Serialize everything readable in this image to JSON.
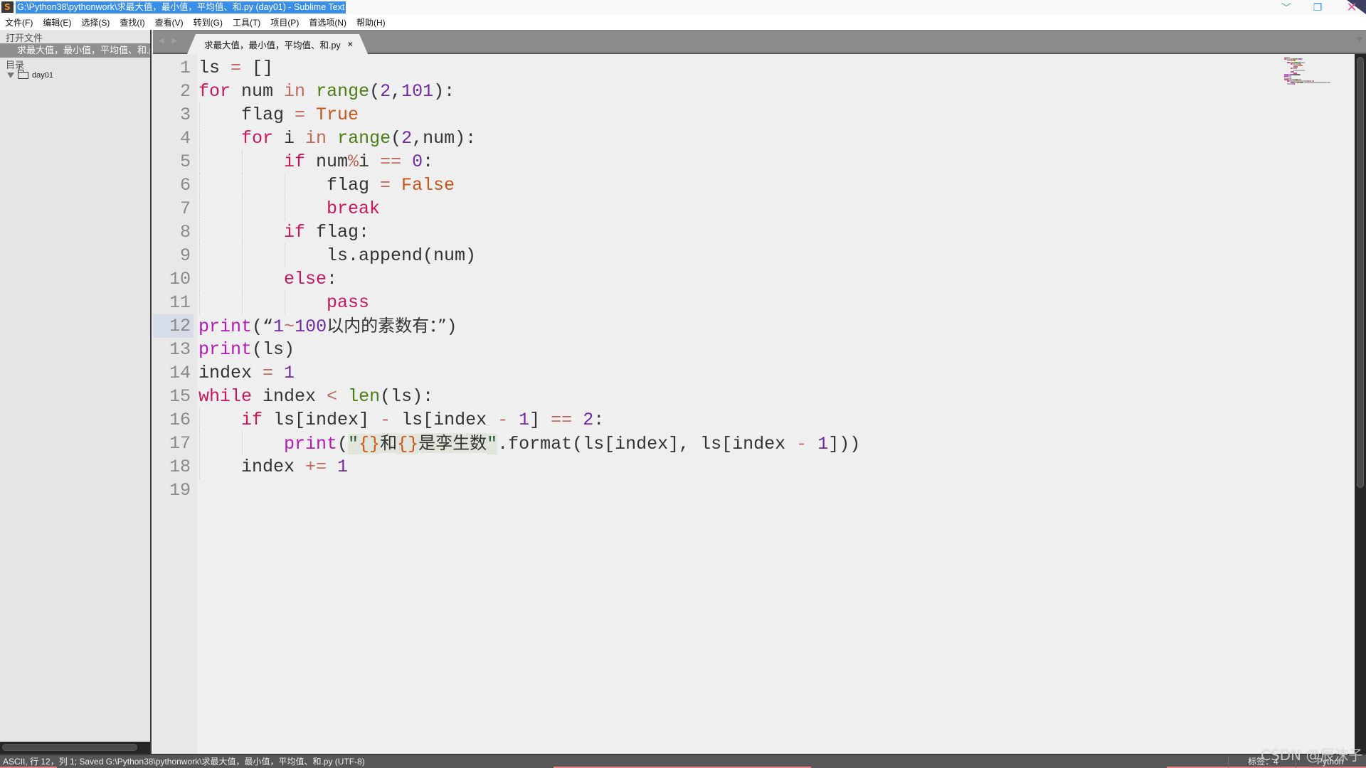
{
  "window": {
    "title": "G:\\Python38\\pythonwork\\求最大值，最小值，平均值、和.py (day01) - Sublime Text",
    "controls": {
      "minimize": "﹀",
      "maximize": "❐",
      "close": "✕"
    }
  },
  "menu": [
    {
      "label": "文件(F)"
    },
    {
      "label": "编辑(E)"
    },
    {
      "label": "选择(S)"
    },
    {
      "label": "查找(I)"
    },
    {
      "label": "查看(V)"
    },
    {
      "label": "转到(G)"
    },
    {
      "label": "工具(T)"
    },
    {
      "label": "项目(P)"
    },
    {
      "label": "首选项(N)"
    },
    {
      "label": "帮助(H)"
    }
  ],
  "sidebar": {
    "open_files_heading": "打开文件",
    "open_files": [
      "求最大值，最小值，平均值、和.py"
    ],
    "folders_heading": "目录",
    "folders": [
      {
        "name": "day01",
        "expanded": true
      }
    ]
  },
  "tabs": [
    {
      "label": "求最大值，最小值，平均值、和.py",
      "close": "×",
      "active": true
    }
  ],
  "tab_nav": "◀ ▶",
  "editor": {
    "current_line": 12,
    "lines": [
      {
        "n": "1",
        "indent": 0,
        "tokens": [
          [
            "txt",
            "ls "
          ],
          [
            "op",
            "="
          ],
          [
            "txt",
            " []"
          ]
        ]
      },
      {
        "n": "2",
        "indent": 0,
        "tokens": [
          [
            "kw",
            "for"
          ],
          [
            "txt",
            " num "
          ],
          [
            "op",
            "in"
          ],
          [
            "txt",
            " "
          ],
          [
            "fn",
            "range"
          ],
          [
            "txt",
            "("
          ],
          [
            "num",
            "2"
          ],
          [
            "txt",
            ","
          ],
          [
            "num",
            "101"
          ],
          [
            "txt",
            "):"
          ]
        ]
      },
      {
        "n": "3",
        "indent": 1,
        "tokens": [
          [
            "txt",
            "flag "
          ],
          [
            "op",
            "="
          ],
          [
            "txt",
            " "
          ],
          [
            "const",
            "True"
          ]
        ]
      },
      {
        "n": "4",
        "indent": 1,
        "tokens": [
          [
            "kw",
            "for"
          ],
          [
            "txt",
            " i "
          ],
          [
            "op",
            "in"
          ],
          [
            "txt",
            " "
          ],
          [
            "fn",
            "range"
          ],
          [
            "txt",
            "("
          ],
          [
            "num",
            "2"
          ],
          [
            "txt",
            ",num):"
          ]
        ]
      },
      {
        "n": "5",
        "indent": 2,
        "tokens": [
          [
            "kw",
            "if"
          ],
          [
            "txt",
            " num"
          ],
          [
            "op",
            "%"
          ],
          [
            "txt",
            "i "
          ],
          [
            "op",
            "=="
          ],
          [
            "txt",
            " "
          ],
          [
            "num",
            "0"
          ],
          [
            "txt",
            ":"
          ]
        ]
      },
      {
        "n": "6",
        "indent": 3,
        "tokens": [
          [
            "txt",
            "flag "
          ],
          [
            "op",
            "="
          ],
          [
            "txt",
            " "
          ],
          [
            "const",
            "False"
          ]
        ]
      },
      {
        "n": "7",
        "indent": 3,
        "tokens": [
          [
            "kw",
            "break"
          ]
        ]
      },
      {
        "n": "8",
        "indent": 2,
        "tokens": [
          [
            "kw",
            "if"
          ],
          [
            "txt",
            " flag:"
          ]
        ]
      },
      {
        "n": "9",
        "indent": 3,
        "tokens": [
          [
            "txt",
            "ls.append(num)"
          ]
        ]
      },
      {
        "n": "10",
        "indent": 2,
        "tokens": [
          [
            "kw",
            "else"
          ],
          [
            "txt",
            ":"
          ]
        ]
      },
      {
        "n": "11",
        "indent": 3,
        "tokens": [
          [
            "kw",
            "pass"
          ]
        ]
      },
      {
        "n": "12",
        "indent": 0,
        "tokens": [
          [
            "print",
            "print"
          ],
          [
            "txt",
            "(“"
          ],
          [
            "num",
            "1"
          ],
          [
            "op",
            "~"
          ],
          [
            "num",
            "100"
          ],
          [
            "cjk",
            "以内的素数有：”"
          ],
          [
            "txt",
            ")"
          ]
        ]
      },
      {
        "n": "13",
        "indent": 0,
        "tokens": [
          [
            "print",
            "print"
          ],
          [
            "txt",
            "(ls)"
          ]
        ]
      },
      {
        "n": "14",
        "indent": 0,
        "tokens": [
          [
            "txt",
            "index "
          ],
          [
            "op",
            "="
          ],
          [
            "txt",
            " "
          ],
          [
            "num",
            "1"
          ]
        ]
      },
      {
        "n": "15",
        "indent": 0,
        "tokens": [
          [
            "kw",
            "while"
          ],
          [
            "txt",
            " index "
          ],
          [
            "op",
            "<"
          ],
          [
            "txt",
            " "
          ],
          [
            "fn",
            "len"
          ],
          [
            "txt",
            "(ls):"
          ]
        ]
      },
      {
        "n": "16",
        "indent": 1,
        "tokens": [
          [
            "kw",
            "if"
          ],
          [
            "txt",
            " ls[index] "
          ],
          [
            "op",
            "-"
          ],
          [
            "txt",
            " ls[index "
          ],
          [
            "op",
            "-"
          ],
          [
            "txt",
            " "
          ],
          [
            "num",
            "1"
          ],
          [
            "txt",
            "] "
          ],
          [
            "op",
            "=="
          ],
          [
            "txt",
            " "
          ],
          [
            "num",
            "2"
          ],
          [
            "txt",
            ":"
          ]
        ]
      },
      {
        "n": "17",
        "indent": 2,
        "tokens": [
          [
            "print",
            "print"
          ],
          [
            "txt",
            "("
          ],
          [
            "str",
            "\""
          ],
          [
            "fmt",
            "{}"
          ],
          [
            "strcjk",
            "和"
          ],
          [
            "fmt",
            "{}"
          ],
          [
            "strcjk",
            "是孪生数"
          ],
          [
            "str",
            "\""
          ],
          [
            "txt",
            ".format(ls[index], ls[index "
          ],
          [
            "op",
            "-"
          ],
          [
            "txt",
            " "
          ],
          [
            "num",
            "1"
          ],
          [
            "txt",
            "]))"
          ]
        ]
      },
      {
        "n": "18",
        "indent": 1,
        "tokens": [
          [
            "txt",
            "index "
          ],
          [
            "op",
            "+="
          ],
          [
            "txt",
            " "
          ],
          [
            "num",
            "1"
          ]
        ]
      },
      {
        "n": "19",
        "indent": 0,
        "tokens": []
      }
    ],
    "syntax_colors": {
      "keyword": "#c9175c",
      "operator": "#c06a5e",
      "number": "#6f2aa4",
      "constant": "#c9561a",
      "builtin": "#4d7d15",
      "print": "#b21bb5",
      "string": "#2f5e3f",
      "text": "#333333"
    }
  },
  "status": {
    "left": "ASCII, 行 12，列 1; Saved G:\\Python38\\pythonwork\\求最大值，最小值，平均值、和.py (UTF-8)",
    "tab_size": "标签：4",
    "syntax": "Python"
  },
  "watermark": "CSDN @辰沫子"
}
